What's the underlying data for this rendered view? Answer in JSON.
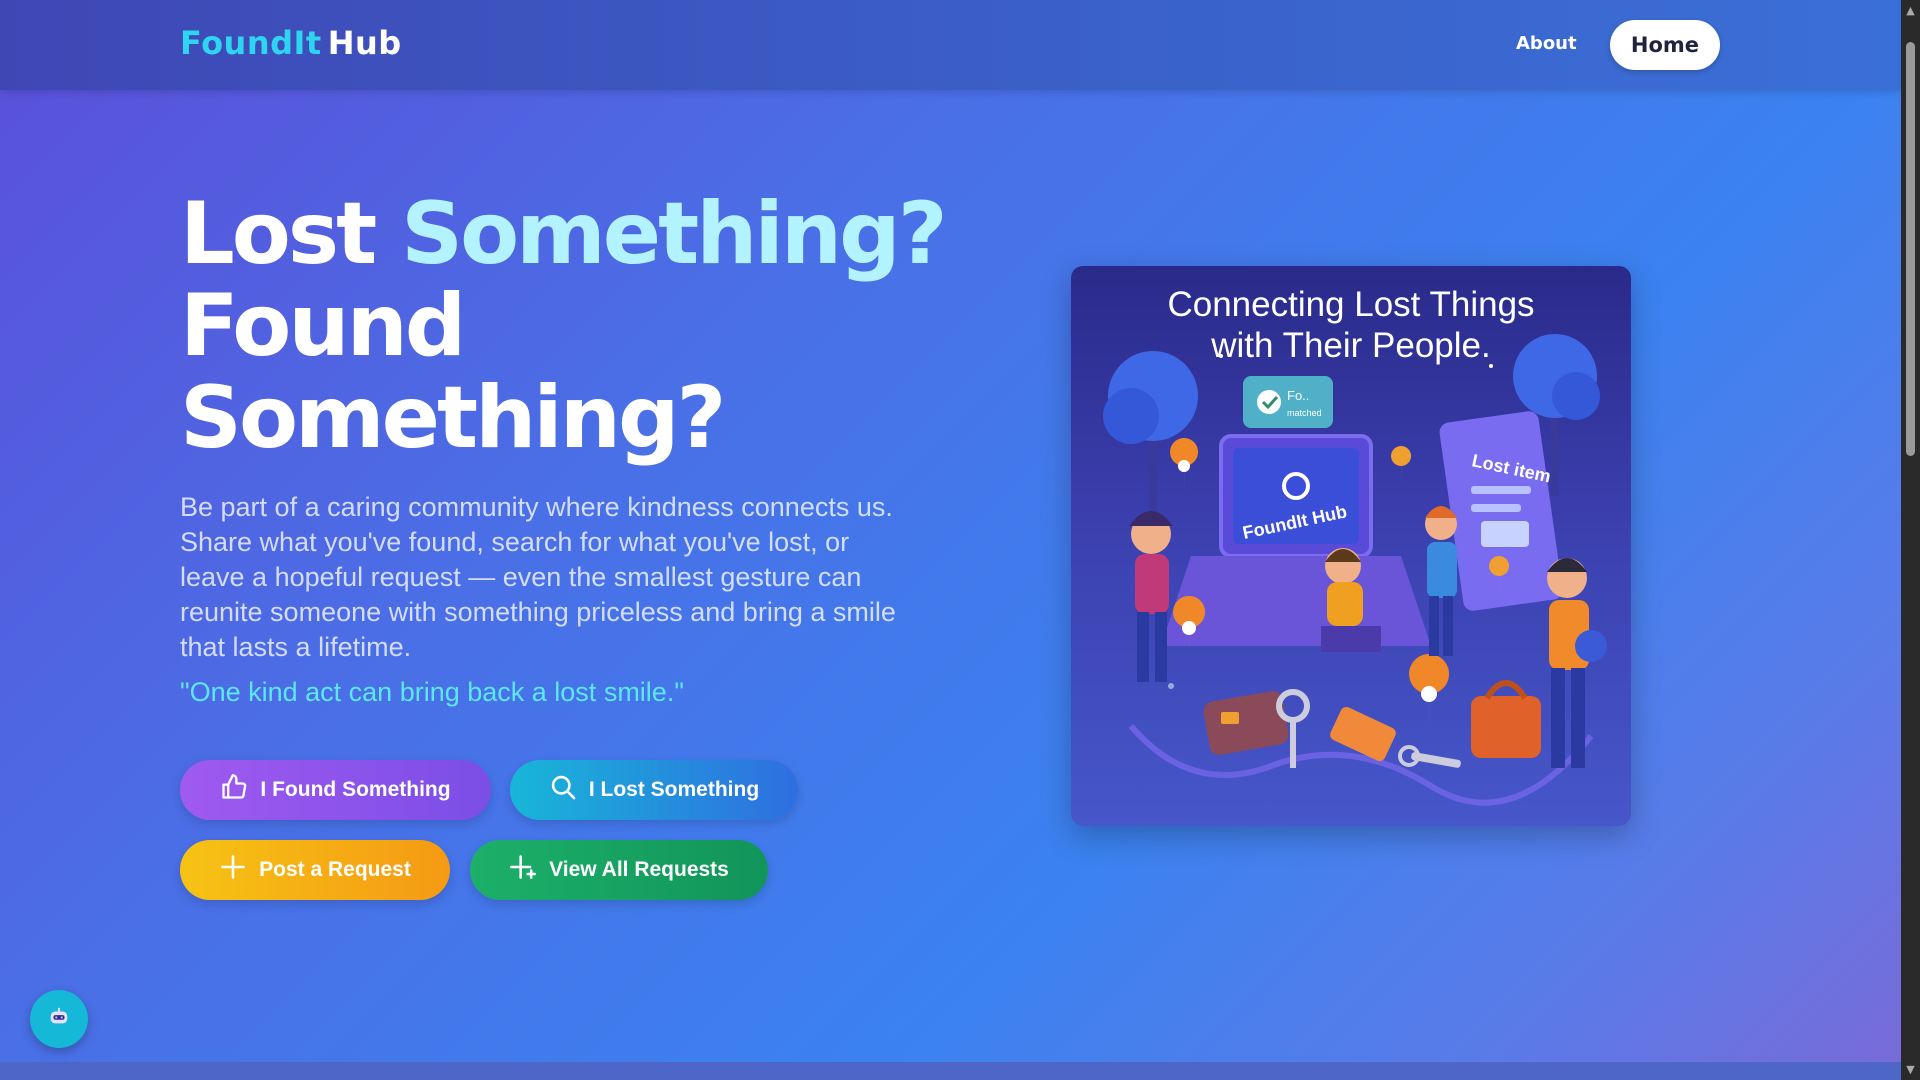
{
  "brand": {
    "part1": "FoundIt",
    "part2": "Hub"
  },
  "nav": {
    "about": "About",
    "home": "Home"
  },
  "hero": {
    "title_line1a": "Lost",
    "title_line1b": "Something?",
    "title_line2": "Found",
    "title_line3": "Something?",
    "description": "Be part of a caring community where kindness connects us. Share what you've found, search for what you've lost, or leave a hopeful request — even the smallest gesture can reunite someone with something priceless and bring a smile that lasts a lifetime.",
    "quote": "\"One kind act can bring back a lost smile.\""
  },
  "buttons": {
    "found": "I Found Something",
    "lost": "I Lost Something",
    "post": "Post a Request",
    "view": "View All Requests"
  },
  "illustration": {
    "title_line1": "Connecting Lost Things",
    "title_line2": "with Their People.",
    "laptop_label": "FoundIt Hub",
    "tablet_label": "Lost item",
    "bubble_label": "Fo..",
    "bubble_sub": "matched"
  },
  "icons": {
    "found": "thumbs-up-icon",
    "lost": "search-icon",
    "post": "plus-icon",
    "view": "sparkle-plus-icon",
    "chat": "robot-icon"
  },
  "colors": {
    "brand_accent": "#2ed4f0",
    "quote": "#5ce8f2",
    "found_btn": "#9a58ee",
    "lost_btn": "#1aa8dc",
    "post_btn": "#f6b314",
    "view_btn": "#17a363"
  }
}
